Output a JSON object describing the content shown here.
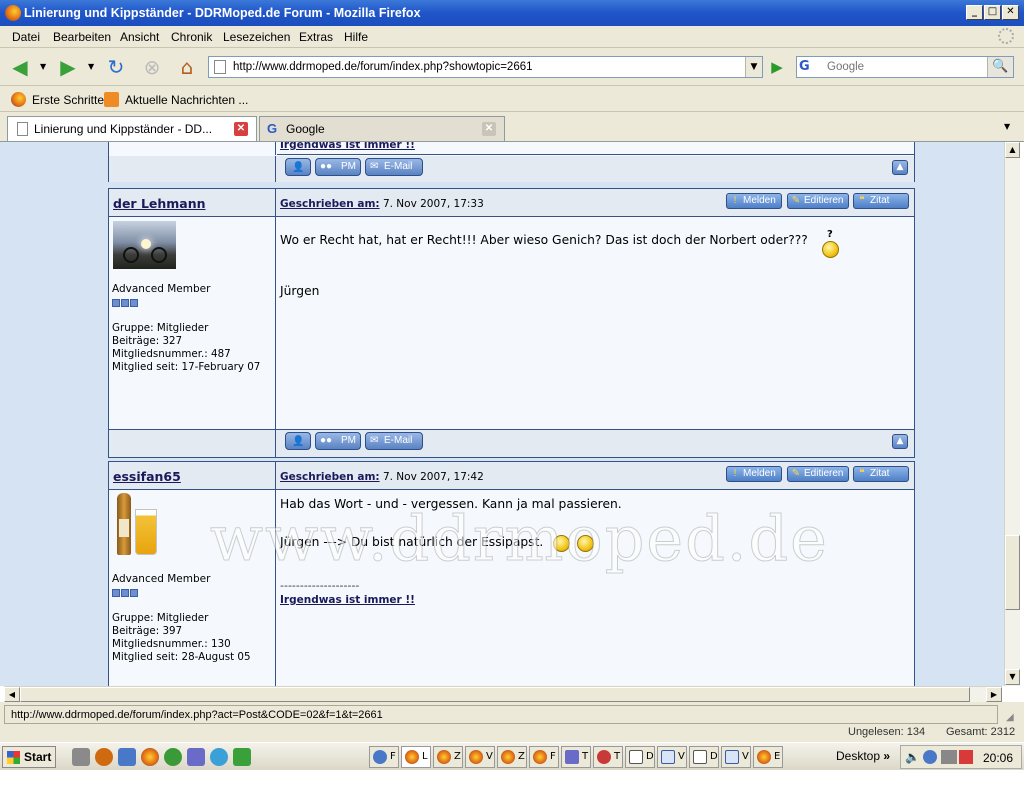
{
  "window": {
    "title": "Linierung und Kippständer - DDRMoped.de Forum - Mozilla Firefox"
  },
  "menu": [
    "Datei",
    "Bearbeiten",
    "Ansicht",
    "Chronik",
    "Lesezeichen",
    "Extras",
    "Hilfe"
  ],
  "navbar": {
    "url": "http://www.ddrmoped.de/forum/index.php?showtopic=2661",
    "search_placeholder": "Google",
    "search_engine_icon": "G"
  },
  "bookmarks": [
    {
      "label": "Erste Schritte"
    },
    {
      "label": "Aktuelle Nachrichten ..."
    }
  ],
  "tabs": [
    {
      "label": "Linierung und Kippständer - DD...",
      "active": true
    },
    {
      "label": "Google",
      "active": false
    }
  ],
  "forum": {
    "prev_sig_link": "Irgendwas ist immer !!",
    "footer_buttons": {
      "profile": "",
      "pm": "PM",
      "email": "E-Mail"
    },
    "header_buttons": {
      "report": "Melden",
      "edit": "Editieren",
      "quote": "Zitat"
    },
    "written_label": "Geschrieben am:",
    "posts": [
      {
        "author": "der Lehmann",
        "date": "7. Nov 2007, 17:33",
        "rank": "Advanced Member",
        "group": "Gruppe: Mitglieder",
        "posts": "Beiträge: 327",
        "member_no": "Mitgliedsnummer.: 487",
        "member_since": "Mitglied seit: 17-February 07",
        "text1": "Wo er Recht hat, hat er Recht!!! Aber wieso Genich? Das ist doch der Norbert oder???",
        "text2": "Jürgen"
      },
      {
        "author": "essifan65",
        "date": "7. Nov 2007, 17:42",
        "rank": "Advanced Member",
        "group": "Gruppe: Mitglieder",
        "posts": "Beiträge: 397",
        "member_no": "Mitgliedsnummer.: 130",
        "member_since": "Mitglied seit: 28-August 05",
        "text1": "Hab das Wort - und - vergessen. Kann ja mal passieren.",
        "text2": "Jürgen ---> Du bist natürlich der Essipapst.",
        "sig_line": "--------------------",
        "sig_link": "Irgendwas ist immer !!"
      }
    ],
    "watermark": "www.ddrmoped.de"
  },
  "status": {
    "text": "http://www.ddrmoped.de/forum/index.php?act=Post&CODE=02&f=1&t=2661",
    "unread": "Ungelesen: 134",
    "total": "Gesamt: 2312"
  },
  "taskbar": {
    "start": "Start",
    "desktop_label": "Desktop",
    "chevron": "»",
    "clock": "20:06",
    "buttons": [
      "F",
      "L",
      "Z",
      "V",
      "Z",
      "F",
      "T",
      "T",
      "D",
      "V",
      "D",
      "V",
      "E"
    ]
  },
  "colors": {
    "titlebar": "#1f55c9",
    "forum_border": "#345487",
    "content_bg": "#d6e3f2"
  }
}
